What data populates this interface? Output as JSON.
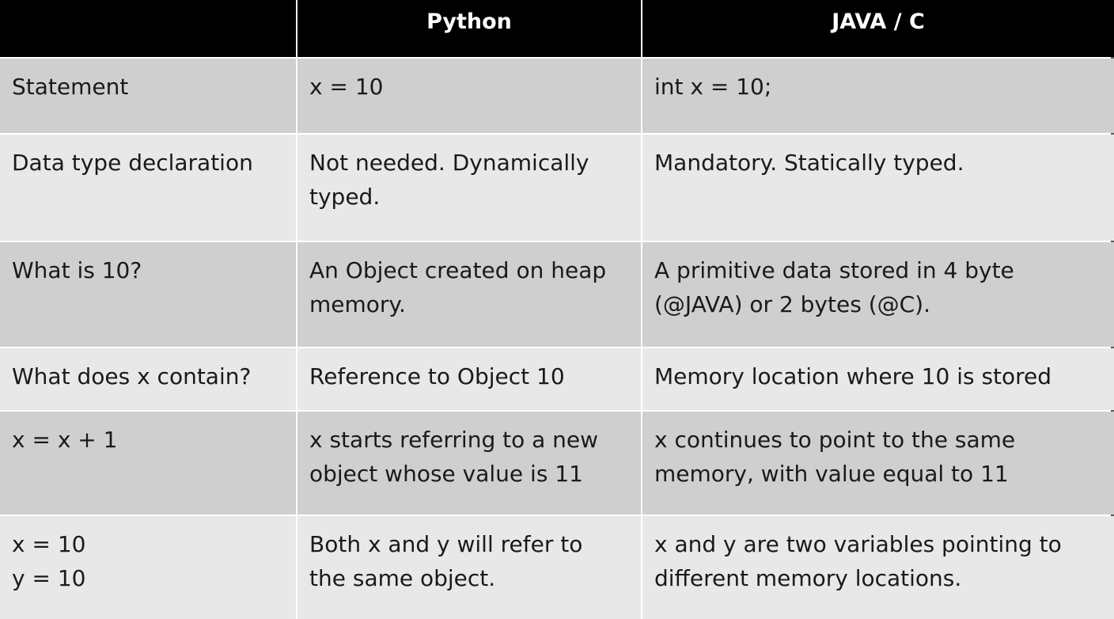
{
  "table": {
    "headers": [
      "",
      "Python",
      "JAVA / C"
    ],
    "rows": [
      {
        "label": "Statement",
        "python": "x = 10",
        "java_c": "int x = 10;"
      },
      {
        "label": "Data type declaration",
        "python": "Not needed. Dynamically\ntyped.",
        "java_c": "Mandatory. Statically typed."
      },
      {
        "label": "What is 10?",
        "python": "An Object created on heap\nmemory.",
        "java_c": "A primitive data stored in 4 byte\n(@JAVA) or 2 bytes (@C)."
      },
      {
        "label": "What does x contain?",
        "python": "Reference to Object 10",
        "java_c": "Memory location where 10 is stored"
      },
      {
        "label": "x = x + 1",
        "python": " x starts referring to a new\nobject whose value is 11",
        "java_c": "x continues to point to the same\nmemory, with value equal to 11"
      },
      {
        "label": "x = 10\ny = 10",
        "python": "Both x and y will refer to\nthe same object.",
        "java_c": "x and y are two variables pointing to\ndifferent memory locations."
      }
    ]
  },
  "colors": {
    "header_bg": "#000000",
    "header_text": "#ffffff",
    "row_dark": "#cfcfcf",
    "row_light": "#e8e8e8",
    "grid_lines": "#ffffff"
  }
}
